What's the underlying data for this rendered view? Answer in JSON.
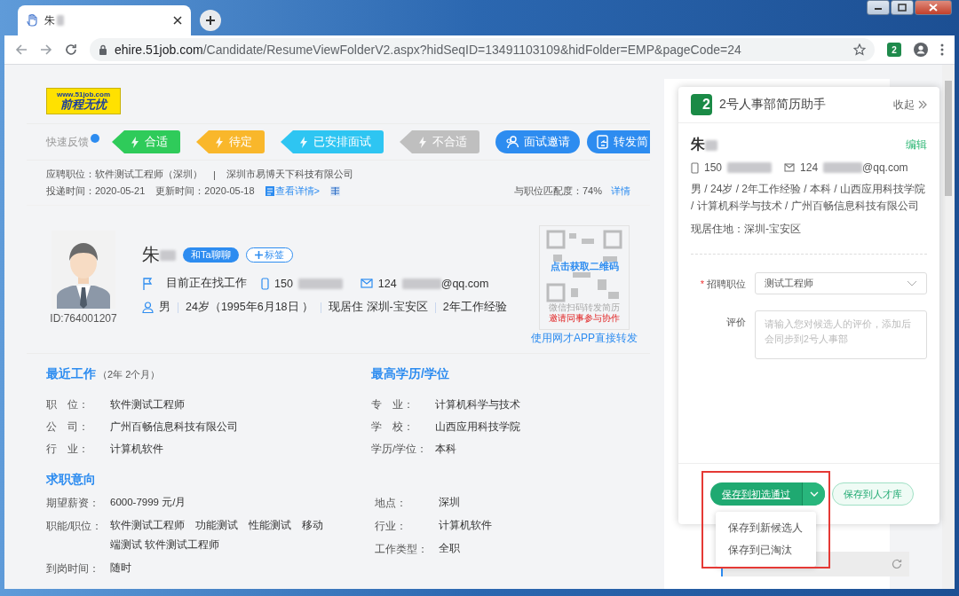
{
  "browser": {
    "tab_title": "朱",
    "url_host": "ehire.51job.com",
    "url_path": "/Candidate/ResumeViewFolderV2.aspx?hidSeqID=13491103109&hidFolder=EMP&pageCode=24",
    "extension_badge": "2"
  },
  "site": {
    "logo_url": "www.51job.com",
    "logo_text": "前程无忧"
  },
  "feedback": {
    "label": "快速反馈",
    "tags": [
      {
        "label": "合适",
        "color": "#2fcb5a"
      },
      {
        "label": "待定",
        "color": "#f9b72b"
      },
      {
        "label": "已安排面试",
        "color": "#2ec5f2"
      },
      {
        "label": "不合适",
        "color": "#bfbfbf"
      }
    ],
    "actions": [
      "面试邀请",
      "转发简"
    ]
  },
  "application": {
    "position": "应聘职位：软件测试工程师（深圳）",
    "separator": "|",
    "company": "深圳市易博天下科技有限公司",
    "delivered": "投递时间：2020-05-21",
    "updated": "更新时间：2020-05-18",
    "details_link": "查看详情>",
    "match": "与职位匹配度：74%",
    "match_link": "详情"
  },
  "profile": {
    "name": "朱",
    "id": "ID:764001207",
    "chat_button": "和Ta聊聊",
    "tag_button": "标签",
    "status": "目前正在找工作",
    "phone": "150",
    "email_prefix": "124",
    "email_suffix": "@qq.com",
    "facts": [
      "男",
      "24岁（1995年6月18日 ）",
      "现居住 深圳-宝安区",
      "2年工作经验"
    ]
  },
  "qr": {
    "title": "点击获取二维码",
    "line1": "微信扫码转发简历",
    "line2": "邀请同事参与协作",
    "link": "使用网才APP直接转发"
  },
  "recent_work": {
    "title": "最近工作",
    "duration": "（2年 2个月）",
    "rows": [
      {
        "label": "职　位：",
        "value": "软件测试工程师"
      },
      {
        "label": "公　司：",
        "value": "广州百畅信息科技有限公司"
      },
      {
        "label": "行　业：",
        "value": "计算机软件"
      }
    ]
  },
  "education": {
    "title": "最高学历/学位",
    "rows": [
      {
        "label": "专　业：",
        "value": "计算机科学与技术"
      },
      {
        "label": "学　校：",
        "value": "山西应用科技学院"
      },
      {
        "label": "学历/学位：",
        "value": "本科"
      }
    ]
  },
  "intention": {
    "title": "求职意向",
    "left": [
      {
        "label": "期望薪资：",
        "value": "6000-7999 元/月"
      },
      {
        "label": "职能/职位：",
        "value": "软件测试工程师　功能测试　性能测试　移动端测试  软件测试工程师"
      },
      {
        "label": "到岗时间：",
        "value": "随时"
      }
    ],
    "right": [
      {
        "label": "地点：",
        "value": "深圳"
      },
      {
        "label": "行业：",
        "value": "计算机软件"
      },
      {
        "label": "工作类型：",
        "value": "全职"
      }
    ]
  },
  "panel": {
    "logo_digit": "2",
    "title": "2号人事部简历助手",
    "collapse": "收起",
    "name": "朱",
    "edit": "编辑",
    "phone": "150",
    "email_prefix": "124",
    "email_suffix": "@qq.com",
    "summary": "男 / 24岁 / 2年工作经验 / 本科 / 山西应用科技学院 / 计算机科学与技术 / 广州百畅信息科技有限公司",
    "residence": "现居住地：深圳-宝安区",
    "required_mark": "*",
    "position_label": "招聘职位",
    "position_value": "测试工程师",
    "comment_label": "评价",
    "comment_placeholder": "请输入您对候选人的评价，添加后会同步到2号人事部",
    "save_primary": "保存到初选通过",
    "save_secondary": "保存到人才库",
    "menu": [
      {
        "label": "保存到新候选人"
      },
      {
        "label": "保存到已淘汰"
      }
    ]
  }
}
